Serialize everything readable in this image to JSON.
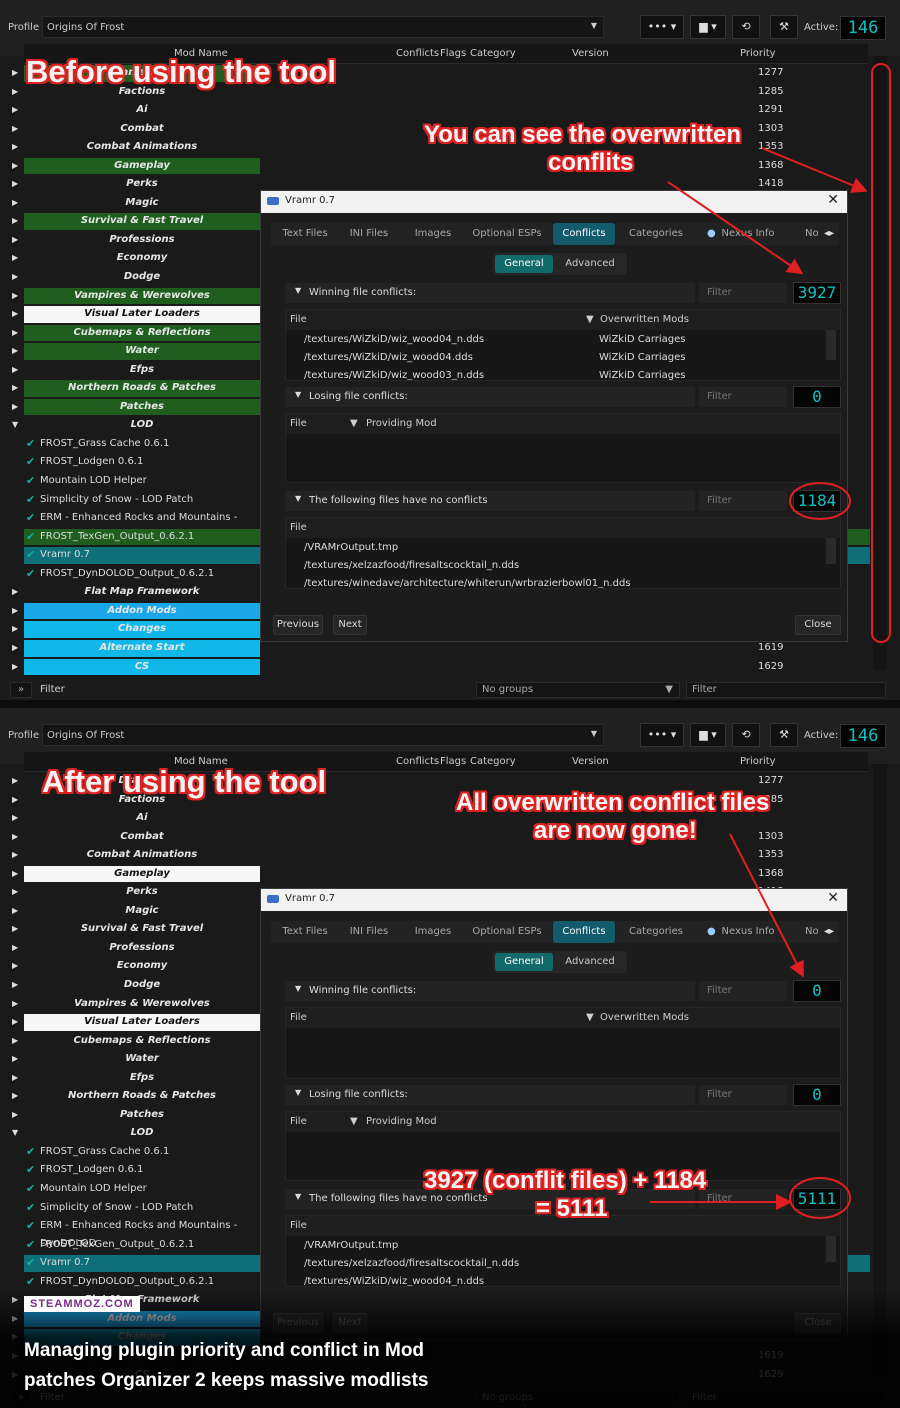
{
  "topbar": {
    "profile_label": "Profile",
    "profile_name": "Origins Of Frost",
    "more_btn": "•••",
    "active_label": "Active:",
    "active_count": "146"
  },
  "columns": {
    "mod_name": "Mod Name",
    "conflicts": "Conflicts",
    "flags": "Flags",
    "category": "Category",
    "version": "Version",
    "priority": "Priority"
  },
  "before_rows": [
    {
      "name": "Framework",
      "bg": "green",
      "prio": "1277"
    },
    {
      "name": "Factions",
      "bg": "",
      "prio": "1285"
    },
    {
      "name": "Ai",
      "bg": "",
      "prio": "1291"
    },
    {
      "name": "Combat",
      "bg": "",
      "prio": "1303"
    },
    {
      "name": "Combat Animations",
      "bg": "",
      "prio": "1353"
    },
    {
      "name": "Gameplay",
      "bg": "green",
      "prio": "1368"
    },
    {
      "name": "Perks",
      "bg": "",
      "prio": "1418"
    },
    {
      "name": "Magic",
      "bg": "",
      "prio": ""
    },
    {
      "name": "Survival & Fast Travel",
      "bg": "green",
      "prio": ""
    },
    {
      "name": "Professions",
      "bg": "",
      "prio": ""
    },
    {
      "name": "Economy",
      "bg": "",
      "prio": ""
    },
    {
      "name": "Dodge",
      "bg": "",
      "prio": ""
    },
    {
      "name": "Vampires & Werewolves",
      "bg": "green",
      "prio": ""
    },
    {
      "name": "Visual Later Loaders",
      "bg": "white",
      "prio": ""
    },
    {
      "name": "Cubemaps & Reflections",
      "bg": "green",
      "prio": ""
    },
    {
      "name": "Water",
      "bg": "green",
      "prio": ""
    },
    {
      "name": "Efps",
      "bg": "",
      "prio": ""
    },
    {
      "name": "Northern Roads & Patches",
      "bg": "green",
      "prio": ""
    },
    {
      "name": "Patches",
      "bg": "green",
      "prio": ""
    },
    {
      "name": "LOD",
      "bg": "",
      "prio": ""
    }
  ],
  "plain_rows": [
    {
      "name": "FROST_Grass Cache 0.6.1",
      "bg": ""
    },
    {
      "name": "FROST_Lodgen 0.6.1",
      "bg": ""
    },
    {
      "name": "Mountain LOD Helper",
      "bg": ""
    },
    {
      "name": "Simplicity of Snow - LOD Patch",
      "bg": ""
    },
    {
      "name": "ERM - Enhanced Rocks and Mountains - DynDOLOD",
      "bg": ""
    },
    {
      "name": "FROST_TexGen_Output_0.6.2.1",
      "bg": "green"
    },
    {
      "name": "Vramr 0.7",
      "bg": "teal"
    },
    {
      "name": "FROST_DynDOLOD_Output_0.6.2.1",
      "bg": ""
    }
  ],
  "tail_rows_before": [
    {
      "name": "Flat Map Framework",
      "bg": "",
      "prio": ""
    },
    {
      "name": "Addon Mods",
      "bg": "lblue",
      "prio": ""
    },
    {
      "name": "Changes",
      "bg": "cyan",
      "prio": ""
    },
    {
      "name": "Alternate Start",
      "bg": "cyan",
      "prio": "1619"
    },
    {
      "name": "CS",
      "bg": "cyan",
      "prio": "1629"
    }
  ],
  "after_rows": [
    {
      "name": "Dragons",
      "bg": "",
      "prio": "1277"
    },
    {
      "name": "Factions",
      "bg": "",
      "prio": "1285"
    },
    {
      "name": "Ai",
      "bg": "",
      "prio": ""
    },
    {
      "name": "Combat",
      "bg": "",
      "prio": "1303"
    },
    {
      "name": "Combat Animations",
      "bg": "",
      "prio": "1353"
    },
    {
      "name": "Gameplay",
      "bg": "white",
      "prio": "1368"
    },
    {
      "name": "Perks",
      "bg": "",
      "prio": "1418"
    },
    {
      "name": "Magic",
      "bg": "",
      "prio": ""
    },
    {
      "name": "Survival & Fast Travel",
      "bg": "",
      "prio": ""
    },
    {
      "name": "Professions",
      "bg": "",
      "prio": ""
    },
    {
      "name": "Economy",
      "bg": "",
      "prio": ""
    },
    {
      "name": "Dodge",
      "bg": "",
      "prio": ""
    },
    {
      "name": "Vampires & Werewolves",
      "bg": "",
      "prio": ""
    },
    {
      "name": "Visual Later Loaders",
      "bg": "white",
      "prio": ""
    },
    {
      "name": "Cubemaps & Reflections",
      "bg": "",
      "prio": ""
    },
    {
      "name": "Water",
      "bg": "",
      "prio": ""
    },
    {
      "name": "Efps",
      "bg": "",
      "prio": ""
    },
    {
      "name": "Northern Roads & Patches",
      "bg": "",
      "prio": ""
    },
    {
      "name": "Patches",
      "bg": "",
      "prio": ""
    },
    {
      "name": "LOD",
      "bg": "",
      "prio": ""
    }
  ],
  "plain_rows_after": [
    {
      "name": "FROST_Grass Cache 0.6.1",
      "bg": ""
    },
    {
      "name": "FROST_Lodgen 0.6.1",
      "bg": ""
    },
    {
      "name": "Mountain LOD Helper",
      "bg": ""
    },
    {
      "name": "Simplicity of Snow - LOD Patch",
      "bg": ""
    },
    {
      "name": "ERM - Enhanced Rocks and Mountains - DynDOLOD",
      "bg": ""
    },
    {
      "name": "FROST_TexGen_Output_0.6.2.1",
      "bg": ""
    },
    {
      "name": "Vramr 0.7",
      "bg": "teal"
    },
    {
      "name": "FROST_DynDOLOD_Output_0.6.2.1",
      "bg": ""
    }
  ],
  "tail_rows_after": [
    {
      "name": "Flat Map Framework",
      "bg": "",
      "prio": ""
    },
    {
      "name": "Addon Mods",
      "bg": "lblue",
      "prio": ""
    },
    {
      "name": "Changes",
      "bg": "cyan",
      "prio": ""
    },
    {
      "name": "",
      "bg": "",
      "prio": "1619"
    },
    {
      "name": "CS",
      "bg": "",
      "prio": "1629"
    }
  ],
  "filterbar": {
    "toggle": "»",
    "filter_label": "Filter",
    "groups": "No groups",
    "filter_placeholder": "Filter"
  },
  "dialog": {
    "title": "Vramr 0.7",
    "tabs": [
      "Text Files",
      "INI Files",
      "Images",
      "Optional ESPs",
      "Conflicts",
      "Categories",
      "Nexus Info",
      "Notes"
    ],
    "subtabs": [
      "General",
      "Advanced"
    ],
    "winning_label": "Winning file conflicts:",
    "losing_label": "Losing file conflicts:",
    "noconf_label": "The following files have no conflicts",
    "filter_placeholder": "Filter",
    "file_col": "File",
    "overwritten_col": "Overwritten Mods",
    "providing_col": "Providing Mod",
    "prev": "Previous",
    "next": "Next",
    "close": "Close"
  },
  "before": {
    "winning_count": "3927",
    "losing_count": "0",
    "noconf_count": "1184",
    "winning_rows": [
      {
        "file": "/textures/WiZkiD/wiz_wood04_n.dds",
        "mod": "WiZkiD Carriages"
      },
      {
        "file": "/textures/WiZkiD/wiz_wood04.dds",
        "mod": "WiZkiD Carriages"
      },
      {
        "file": "/textures/WiZkiD/wiz_wood03_n.dds",
        "mod": "WiZkiD Carriages"
      }
    ],
    "noconf_rows": [
      "/VRAMrOutput.tmp",
      "/textures/xelzazfood/firesaltscocktail_n.dds",
      "/textures/winedave/architecture/whiterun/wrbrazierbowl01_n.dds"
    ]
  },
  "after": {
    "winning_count": "0",
    "losing_count": "0",
    "noconf_count": "5111",
    "noconf_rows": [
      "/VRAMrOutput.tmp",
      "/textures/xelzazfood/firesaltscocktail_n.dds",
      "/textures/WiZkiD/wiz_wood04_n.dds"
    ]
  },
  "annotations": {
    "before_title": "Before using the tool",
    "before_note_1": "You can see the overwritten",
    "before_note_2": "conflits",
    "after_title": "After using the tool",
    "after_note_1": "All overwritten conflict files",
    "after_note_2": "are now gone!",
    "sum_1": "3927 (conflit files) + 1184",
    "sum_2": "= 5111"
  },
  "footer": {
    "badge": "STEAMMOZ.COM",
    "caption_1": "Managing plugin priority and conflict in Mod",
    "caption_2": "patches Organizer 2 keeps massive modlists"
  },
  "colors": {
    "green": "#1f5e1f",
    "teal": "#0f6f78",
    "light_blue": "#1aa7e8",
    "lcd": "#10c0c0",
    "annotation_red": "#e02020"
  }
}
